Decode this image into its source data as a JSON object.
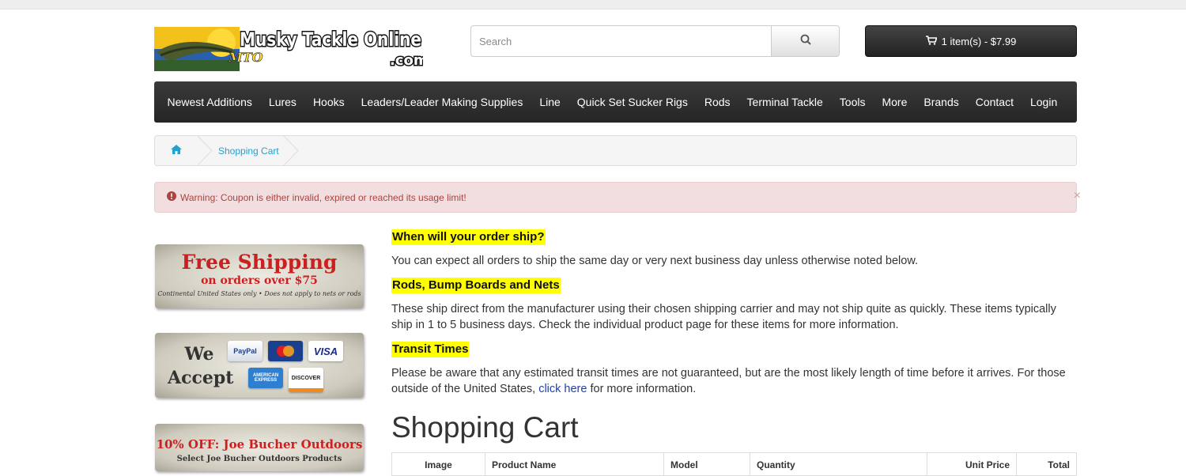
{
  "header": {
    "logo_text": "Musky Tackle Online",
    "logo_domain": ".com",
    "logo_badge": "MTO",
    "search_placeholder": "Search",
    "cart_label": "1 item(s) - $7.99"
  },
  "nav": {
    "items": [
      "Newest Additions",
      "Lures",
      "Hooks",
      "Leaders/Leader Making Supplies",
      "Line",
      "Quick Set Sucker Rigs",
      "Rods",
      "Terminal Tackle",
      "Tools",
      "More",
      "Brands",
      "Contact",
      "Login"
    ]
  },
  "breadcrumb": {
    "current": "Shopping Cart"
  },
  "alert": {
    "text": "Warning: Coupon is either invalid, expired or reached its usage limit!",
    "close": "×"
  },
  "banners": {
    "shipping": {
      "title": "Free Shipping",
      "subtitle": "on orders over $75",
      "note": "Continental United States only • Does not apply to nets or rods"
    },
    "payment": {
      "line1": "We",
      "line2": "Accept",
      "cards": [
        "PayPal",
        "MasterCard",
        "VISA",
        "AMERICAN EXPRESS",
        "DISCOVER"
      ]
    },
    "promo": {
      "title": "10% OFF: Joe Bucher Outdoors",
      "subtitle": "Select Joe Bucher Outdoors Products"
    }
  },
  "content": {
    "h1": "When will your order ship?",
    "p1": "You can expect all orders to ship the same day or very next business day unless otherwise noted below.",
    "h2": "Rods, Bump Boards and Nets",
    "p2": "These ship direct from the manufacturer using their chosen shipping carrier and may not ship quite as quickly. These items typically ship in 1 to 5 business days. Check the individual product page for these items for more information.",
    "h3": "Transit Times",
    "p3_start": "Please be aware that any estimated transit times are not guaranteed, but are the most likely length of time before it arrives. For those outside of the United States, ",
    "p3_link": "click here",
    "p3_end": " for more information."
  },
  "cart": {
    "title": "Shopping Cart",
    "columns": [
      "Image",
      "Product Name",
      "Model",
      "Quantity",
      "Unit Price",
      "Total"
    ]
  },
  "colors": {
    "accent": "#23a1d1",
    "highlight": "#ffff00",
    "alert_bg": "#f2dede",
    "alert_text": "#a94442",
    "nav_bg": "#2f2f2f"
  },
  "icons": {
    "search": "search-icon",
    "cart": "cart-icon",
    "home": "home-icon",
    "warning": "exclamation-circle-icon"
  }
}
